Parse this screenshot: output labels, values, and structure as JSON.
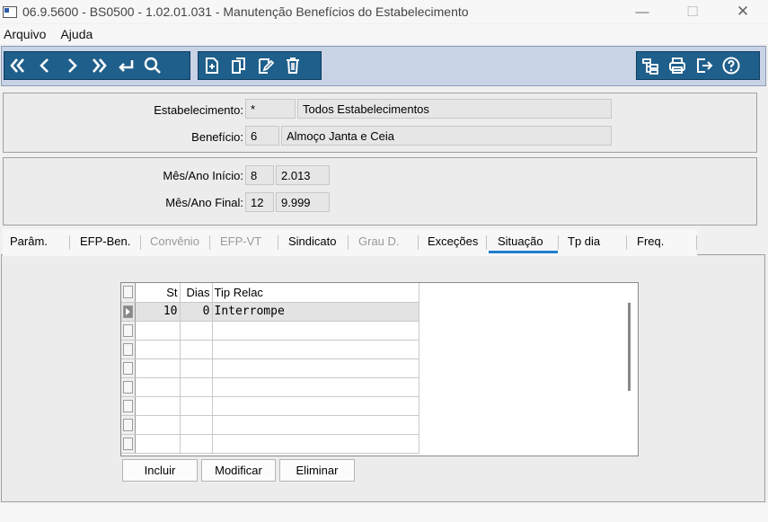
{
  "window": {
    "title": "06.9.5600 - BS0500 - 1.02.01.031 - Manutenção Benefícios do Estabelecimento",
    "minimize": "—",
    "maximize": "☐",
    "close": "✕"
  },
  "menu": {
    "items": [
      "Arquivo",
      "Ajuda"
    ]
  },
  "toolbar": {
    "nav_icons": [
      "first-icon",
      "previous-icon",
      "next-icon",
      "last-icon",
      "goto-icon",
      "search-icon"
    ],
    "edit_icons": [
      "new-icon",
      "copy-icon",
      "edit-icon",
      "delete-icon"
    ],
    "right_icons": [
      "tree-icon",
      "print-icon",
      "exit-icon",
      "help-icon"
    ]
  },
  "header": {
    "estabelecimento_label": "Estabelecimento:",
    "estabelecimento_value": "*",
    "estabelecimento_desc": "Todos Estabelecimentos",
    "beneficio_label": "Benefício:",
    "beneficio_value": "6",
    "beneficio_desc": "Almoço Janta e Ceia"
  },
  "period": {
    "inicio_label": "Mês/Ano Início:",
    "inicio_mes": "8",
    "inicio_ano": "2.013",
    "final_label": "Mês/Ano Final:",
    "final_mes": "12",
    "final_ano": "9.999"
  },
  "tabs": [
    {
      "label": "Parâm.",
      "state": "normal"
    },
    {
      "label": "EFP-Ben.",
      "state": "normal"
    },
    {
      "label": "Convênio",
      "state": "disabled"
    },
    {
      "label": "EFP-VT",
      "state": "disabled"
    },
    {
      "label": "Sindicato",
      "state": "normal"
    },
    {
      "label": "Grau D.",
      "state": "disabled"
    },
    {
      "label": "Exceções",
      "state": "normal"
    },
    {
      "label": "Situação",
      "state": "active"
    },
    {
      "label": "Tp dia",
      "state": "normal"
    },
    {
      "label": "Freq.",
      "state": "normal"
    }
  ],
  "grid": {
    "columns": [
      "St",
      "Dias",
      "Tip Relac"
    ],
    "rows": [
      {
        "st": "10",
        "dias": "0",
        "tip": "Interrompe"
      }
    ]
  },
  "buttons": {
    "incluir": "Incluir",
    "modificar": "Modificar",
    "eliminar": "Eliminar"
  },
  "colors": {
    "toolbar_bg": "#c8d3e6",
    "toolbar_group": "#1f5f8b",
    "active_tab_underline": "#1f7fd1"
  }
}
